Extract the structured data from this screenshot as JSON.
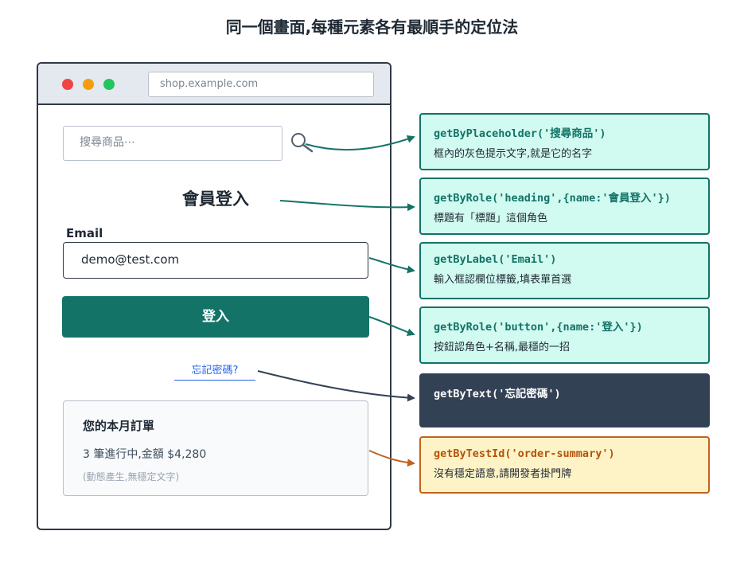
{
  "title": "同一個畫面,每種元素各有最順手的定位法",
  "browser": {
    "url": "shop.example.com",
    "search_placeholder": "搜尋商品⋯",
    "heading": "會員登入",
    "email_label": "Email",
    "email_value": "demo@test.com",
    "login_button": "登入",
    "forgot_link": "忘記密碼?",
    "order_card": {
      "title": "您的本月訂單",
      "status": "3 筆進行中,金額 $4,280",
      "note": "(動態產生,無穩定文字)"
    }
  },
  "callouts": [
    {
      "code": "getByPlaceholder('搜尋商品')",
      "desc": "框內的灰色提示文字,就是它的名字"
    },
    {
      "code": "getByRole('heading',{name:'會員登入'})",
      "desc": "標題有「標題」這個角色"
    },
    {
      "code": "getByLabel('Email')",
      "desc": "輸入框認欄位標籤,填表單首選"
    },
    {
      "code": "getByRole('button',{name:'登入'})",
      "desc": "按鈕認角色+名稱,最穩的一招"
    },
    {
      "code": "getByText('忘記密碼')",
      "desc": ""
    },
    {
      "code": "getByTestId('order-summary')",
      "desc": "沒有穩定語意,請開發者掛門牌"
    }
  ],
  "colors": {
    "teal": "#137367",
    "dark": "#334155",
    "amber": "#c2621e"
  }
}
